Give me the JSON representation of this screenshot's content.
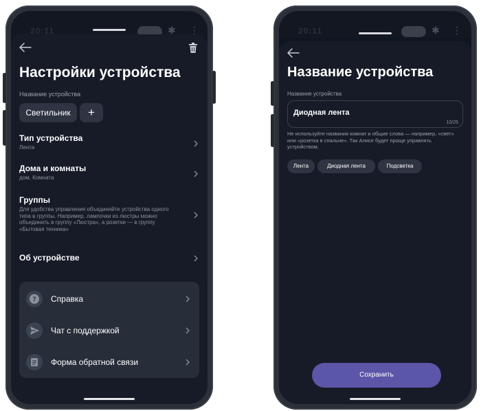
{
  "left": {
    "status_time": "20:11",
    "title": "Настройки устройства",
    "name_caption": "Название устройства",
    "name_chip": "Светильник",
    "add_symbol": "+",
    "rows": [
      {
        "title": "Тип устройства",
        "subtitle": "Лента"
      },
      {
        "title": "Дома и комнаты",
        "subtitle": "дом, Комната"
      },
      {
        "title": "Группы",
        "subtitle": "Для удобства управления объединяйте устройства одного типа в группы. Например, лампочки из люстры можно объединить в группу «Люстра», а розетки — в группу «Бытовая техника»"
      },
      {
        "title": "Об устройстве",
        "subtitle": ""
      }
    ],
    "help_items": [
      {
        "label": "Справка",
        "icon": "question-icon"
      },
      {
        "label": "Чат с поддержкой",
        "icon": "send-icon"
      },
      {
        "label": "Форма обратной связи",
        "icon": "form-icon"
      }
    ]
  },
  "right": {
    "status_time": "20:11",
    "title": "Название устройства",
    "caption": "Название устройства",
    "input_value": "Диодная лента",
    "counter": "10/25",
    "hint": "Не используйте названия комнат и общие слова — например, «свет» или «розетка в спальне». Так Алисе будет проще управлять устройством.",
    "suggestions": [
      "Лента",
      "Диодная лента",
      "Подсветка"
    ],
    "save_label": "Сохранить"
  },
  "colors": {
    "background": "#0f1521",
    "sheet": "#161b27",
    "card": "#272d39",
    "chip": "#2e3441",
    "accent": "#5b56a8"
  }
}
